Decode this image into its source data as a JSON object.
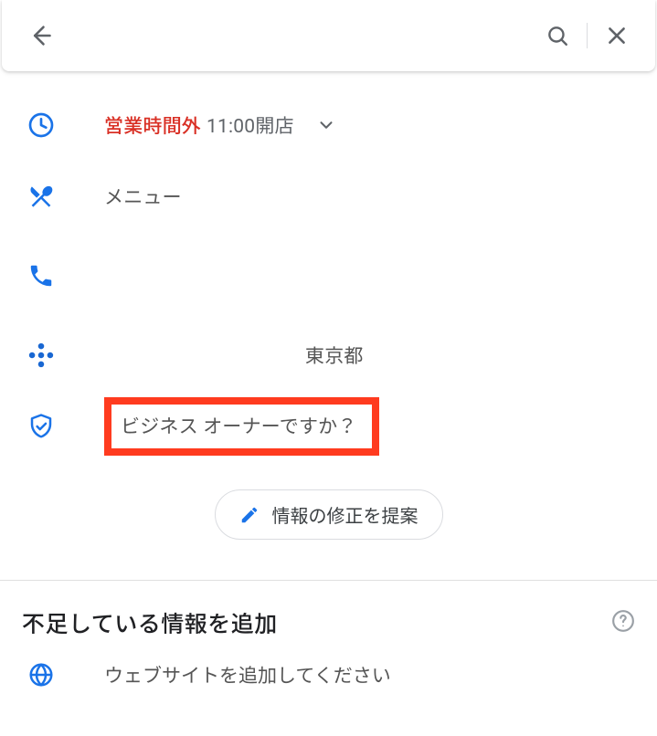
{
  "hours": {
    "status": "営業時間外",
    "opens": "11:00開店"
  },
  "menu_label": "メニュー",
  "location_text": "東京都",
  "owner_question": "ビジネス オーナーですか？",
  "suggest_edit_label": "情報の修正を提案",
  "missing_section_title": "不足している情報を追加",
  "add_website_label": "ウェブサイトを追加してください"
}
